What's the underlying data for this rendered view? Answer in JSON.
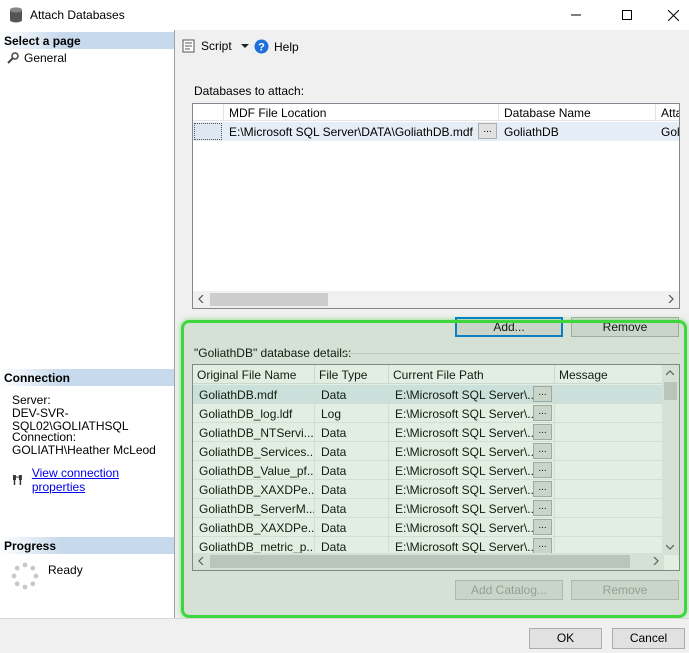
{
  "window": {
    "title": "Attach Databases"
  },
  "left_pane": {
    "select_page_header": "Select a page",
    "pages": [
      {
        "label": "General"
      }
    ],
    "connection_header": "Connection",
    "server_label": "Server:",
    "server_value": "DEV-SVR-SQL02\\GOLIATHSQL",
    "connection_label": "Connection:",
    "connection_value": "GOLIATH\\Heather McLeod",
    "view_link": "View connection properties",
    "progress_header": "Progress",
    "progress_status": "Ready"
  },
  "toolbar": {
    "script_label": "Script",
    "help_label": "Help"
  },
  "attach": {
    "label": "Databases to attach:",
    "columns": [
      "MDF File Location",
      "Database Name",
      "Atta"
    ],
    "rows": [
      {
        "mdf": "E:\\Microsoft SQL Server\\DATA\\GoliathDB.mdf",
        "db_name": "GoliathDB",
        "attach_as": "Gol"
      }
    ],
    "ellipsis": "...",
    "add_button": "Add...",
    "remove_button": "Remove"
  },
  "details": {
    "label": "\"GoliathDB\" database details:",
    "columns": [
      "Original File Name",
      "File Type",
      "Current File Path",
      "Message"
    ],
    "rows": [
      {
        "name": "GoliathDB.mdf",
        "type": "Data",
        "path": "E:\\Microsoft SQL Server\\..."
      },
      {
        "name": "GoliathDB_log.ldf",
        "type": "Log",
        "path": "E:\\Microsoft SQL Server\\..."
      },
      {
        "name": "GoliathDB_NTServi...",
        "type": "Data",
        "path": "E:\\Microsoft SQL Server\\..."
      },
      {
        "name": "GoliathDB_Services...",
        "type": "Data",
        "path": "E:\\Microsoft SQL Server\\..."
      },
      {
        "name": "GoliathDB_Value_pf...",
        "type": "Data",
        "path": "E:\\Microsoft SQL Server\\..."
      },
      {
        "name": "GoliathDB_XAXDPe...",
        "type": "Data",
        "path": "E:\\Microsoft SQL Server\\..."
      },
      {
        "name": "GoliathDB_ServerM...",
        "type": "Data",
        "path": "E:\\Microsoft SQL Server\\..."
      },
      {
        "name": "GoliathDB_XAXDPe...",
        "type": "Data",
        "path": "E:\\Microsoft SQL Server\\..."
      },
      {
        "name": "GoliathDB_metric_p...",
        "type": "Data",
        "path": "E:\\Microsoft SQL Server\\..."
      }
    ],
    "ellipsis": "...",
    "add_catalog_button": "Add Catalog...",
    "remove_button": "Remove"
  },
  "footer": {
    "ok_button": "OK",
    "cancel_button": "Cancel"
  },
  "colors": {
    "highlight": "#3dd63d",
    "selection": "#e5eef7",
    "link": "#0000ee",
    "focus": "#0078d7"
  }
}
